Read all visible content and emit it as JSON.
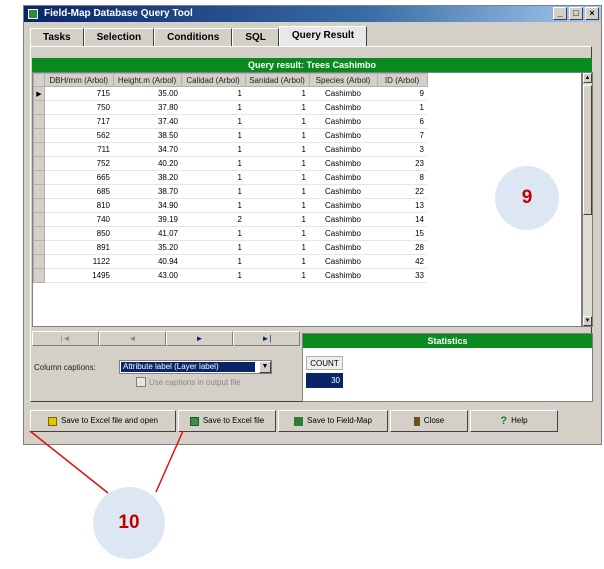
{
  "window": {
    "title": "Field-Map Database Query Tool",
    "controls": [
      "_",
      "□",
      "×"
    ]
  },
  "tabs": [
    {
      "label": "Tasks",
      "active": false
    },
    {
      "label": "Selection",
      "active": false
    },
    {
      "label": "Conditions",
      "active": false
    },
    {
      "label": "SQL",
      "active": false
    },
    {
      "label": "Query Result",
      "active": true
    }
  ],
  "result": {
    "header": "Query result:  Trees Cashimbo",
    "columns": [
      "DBH/mm (Arbol)",
      "Height.m (Arbol)",
      "Calidad (Arbol)",
      "Sanidad (Arbol)",
      "Species (Arbol)",
      "ID (Arbol)"
    ],
    "rows": [
      [
        "715",
        "35.00",
        "1",
        "1",
        "Cashimbo",
        "9"
      ],
      [
        "750",
        "37.80",
        "1",
        "1",
        "Cashimbo",
        "1"
      ],
      [
        "717",
        "37.40",
        "1",
        "1",
        "Cashimbo",
        "6"
      ],
      [
        "562",
        "38.50",
        "1",
        "1",
        "Cashimbo",
        "7"
      ],
      [
        "711",
        "34.70",
        "1",
        "1",
        "Cashimbo",
        "3"
      ],
      [
        "752",
        "40.20",
        "1",
        "1",
        "Cashimbo",
        "23"
      ],
      [
        "665",
        "38.20",
        "1",
        "1",
        "Cashimbo",
        "8"
      ],
      [
        "685",
        "38.70",
        "1",
        "1",
        "Cashimbo",
        "22"
      ],
      [
        "810",
        "34.90",
        "1",
        "1",
        "Cashimbo",
        "13"
      ],
      [
        "740",
        "39.19",
        "2",
        "1",
        "Cashimbo",
        "14"
      ],
      [
        "850",
        "41.07",
        "1",
        "1",
        "Cashimbo",
        "15"
      ],
      [
        "891",
        "35.20",
        "1",
        "1",
        "Cashimbo",
        "28"
      ],
      [
        "1122",
        "40.94",
        "1",
        "1",
        "Cashimbo",
        "42"
      ],
      [
        "1495",
        "43.00",
        "1",
        "1",
        "Cashimbo",
        "33"
      ]
    ]
  },
  "navigator": [
    "|◄",
    "◄",
    "►",
    "►|"
  ],
  "captions": {
    "label": "Column captions:",
    "selected": "Attribute label (Layer label)",
    "checkbox_label": "Use captions in output file"
  },
  "statistics": {
    "header": "Statistics",
    "count_label": "COUNT",
    "count_value": "30"
  },
  "buttons": {
    "save_excel_open": "Save to Excel file and open",
    "save_excel": "Save to Excel file",
    "save_fieldmap": "Save to Field-Map",
    "close": "Close",
    "help": "Help"
  },
  "callouts": {
    "nine": "9",
    "ten": "10"
  },
  "icons": [
    "app-icon",
    "excel-open-icon",
    "excel-icon",
    "fieldmap-icon",
    "close-icon",
    "help-icon"
  ],
  "colors": {
    "accent_green": "#0a8a1e",
    "selection_blue": "#0a246a",
    "callout_text": "#c00000",
    "callout_fill": "#dde7f4"
  }
}
